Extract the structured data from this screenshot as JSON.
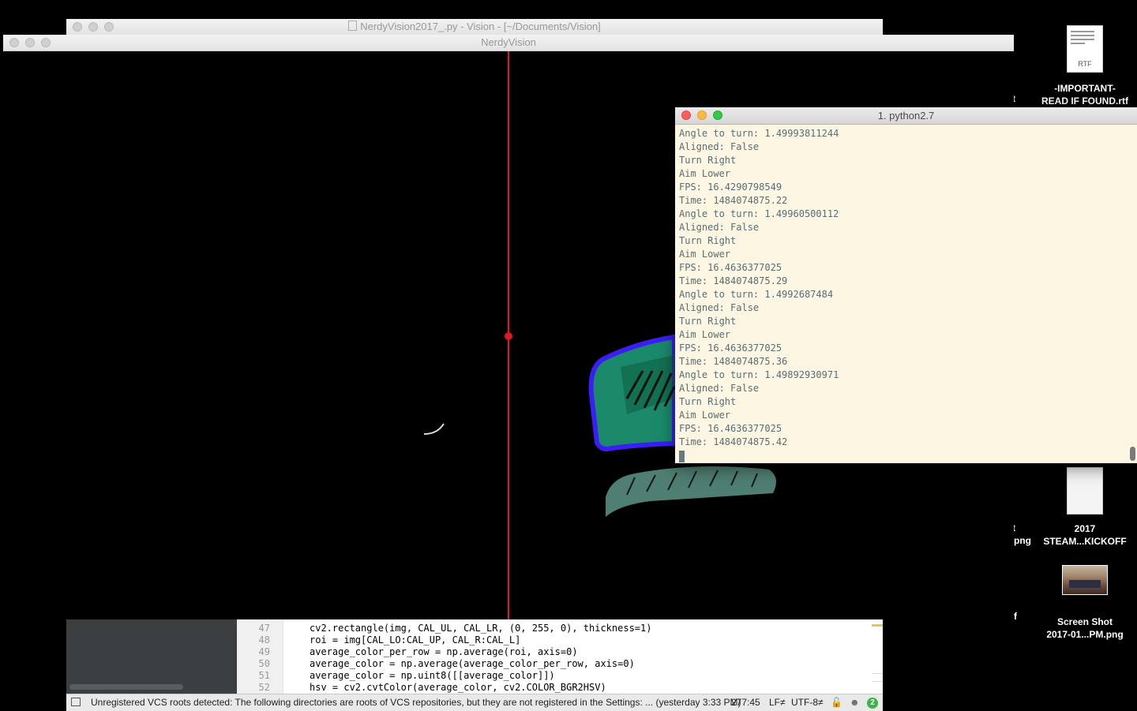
{
  "desktop": {
    "icons": [
      {
        "label_line1": "-IMPORTANT-",
        "label_line2": "READ IF FOUND.rtf",
        "type": "RTF",
        "kind": "document"
      },
      {
        "label_line1": "2017",
        "label_line2": "STEAM...KICKOFF",
        "kind": "document"
      },
      {
        "label_line1": "Screen Shot",
        "label_line2": "2017-01...PM.png",
        "kind": "image"
      }
    ],
    "partial_labels": [
      "t",
      "t",
      "png",
      "...f"
    ]
  },
  "ide": {
    "title": "NerdyVision2017_.py - Vision - [~/Documents/Vision]",
    "code_lines": [
      {
        "num": "47",
        "text": "cv2.rectangle(img, CAL_UL, CAL_LR, (0, 255, 0), thickness=1)"
      },
      {
        "num": "48",
        "text": "roi = img[CAL_LO:CAL_UP, CAL_R:CAL_L]"
      },
      {
        "num": "49",
        "text": "average_color_per_row = np.average(roi, axis=0)"
      },
      {
        "num": "50",
        "text": "average_color = np.average(average_color_per_row, axis=0)"
      },
      {
        "num": "51",
        "text": "average_color = np.uint8([[average_color]])"
      },
      {
        "num": "52",
        "text": "hsv = cv2.cvtColor(average_color, cv2.COLOR_BGR2HSV)"
      }
    ],
    "status": {
      "message": "Unregistered VCS roots detected: The following directories are roots of VCS repositories, but they are not registered in the Settings: ... (yesterday 3:33 PM)",
      "position": "277:45",
      "line_separator": "LF≠",
      "encoding": "UTF-8≠",
      "badge_count": "2"
    }
  },
  "vision_window": {
    "title": "NerdyVision"
  },
  "terminal": {
    "title": "1. python2.7",
    "lines": [
      "Angle to turn: 1.49993811244",
      "Aligned: False",
      "Turn Right",
      "Aim Lower",
      "FPS: 16.4290798549",
      "Time: 1484074875.22",
      "Angle to turn: 1.49960500112",
      "Aligned: False",
      "Turn Right",
      "Aim Lower",
      "FPS: 16.4636377025",
      "Time: 1484074875.29",
      "Angle to turn: 1.4992687484",
      "Aligned: False",
      "Turn Right",
      "Aim Lower",
      "FPS: 16.4636377025",
      "Time: 1484074875.36",
      "Angle to turn: 1.49892930971",
      "Aligned: False",
      "Turn Right",
      "Aim Lower",
      "FPS: 16.4636377025",
      "Time: 1484074875.42"
    ]
  }
}
